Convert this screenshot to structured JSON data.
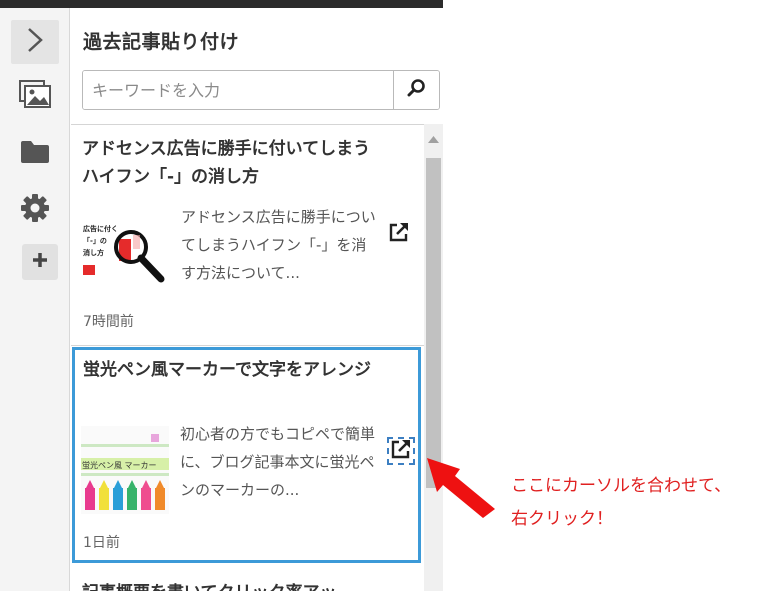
{
  "rail": {
    "icons": [
      "chevron-right-icon",
      "media-icon",
      "folder-icon",
      "gear-icon",
      "plus-icon"
    ]
  },
  "panel": {
    "title": "過去記事貼り付け",
    "search": {
      "placeholder": "キーワードを入力",
      "value": ""
    }
  },
  "articles": [
    {
      "title": "アドセンス広告に勝手に付いてしまうハイフン「-」の消し方",
      "excerpt": "アドセンス広告に勝手についてしまうハイフン「-」を消す方法について...",
      "time": "7時間前",
      "thumb_text": [
        "広告に付く",
        "「-」の",
        "消し方"
      ]
    },
    {
      "title": "蛍光ペン風マーカーで文字をアレンジ",
      "excerpt": "初心者の方でもコピペで簡単に、ブログ記事本文に蛍光ペンのマーカーの...",
      "time": "1日前",
      "thumb_text": [
        "蛍光ペン風 マーカー"
      ]
    },
    {
      "title": "記事概要を書いてクリック率アッ"
    }
  ],
  "annotation": {
    "line1": "ここにカーソルを合わせて、",
    "line2": "右クリック！",
    "color": "#e02020"
  },
  "colors": {
    "selection": "#3c9ad8",
    "scrollbar_thumb": "#c1c1c1"
  }
}
